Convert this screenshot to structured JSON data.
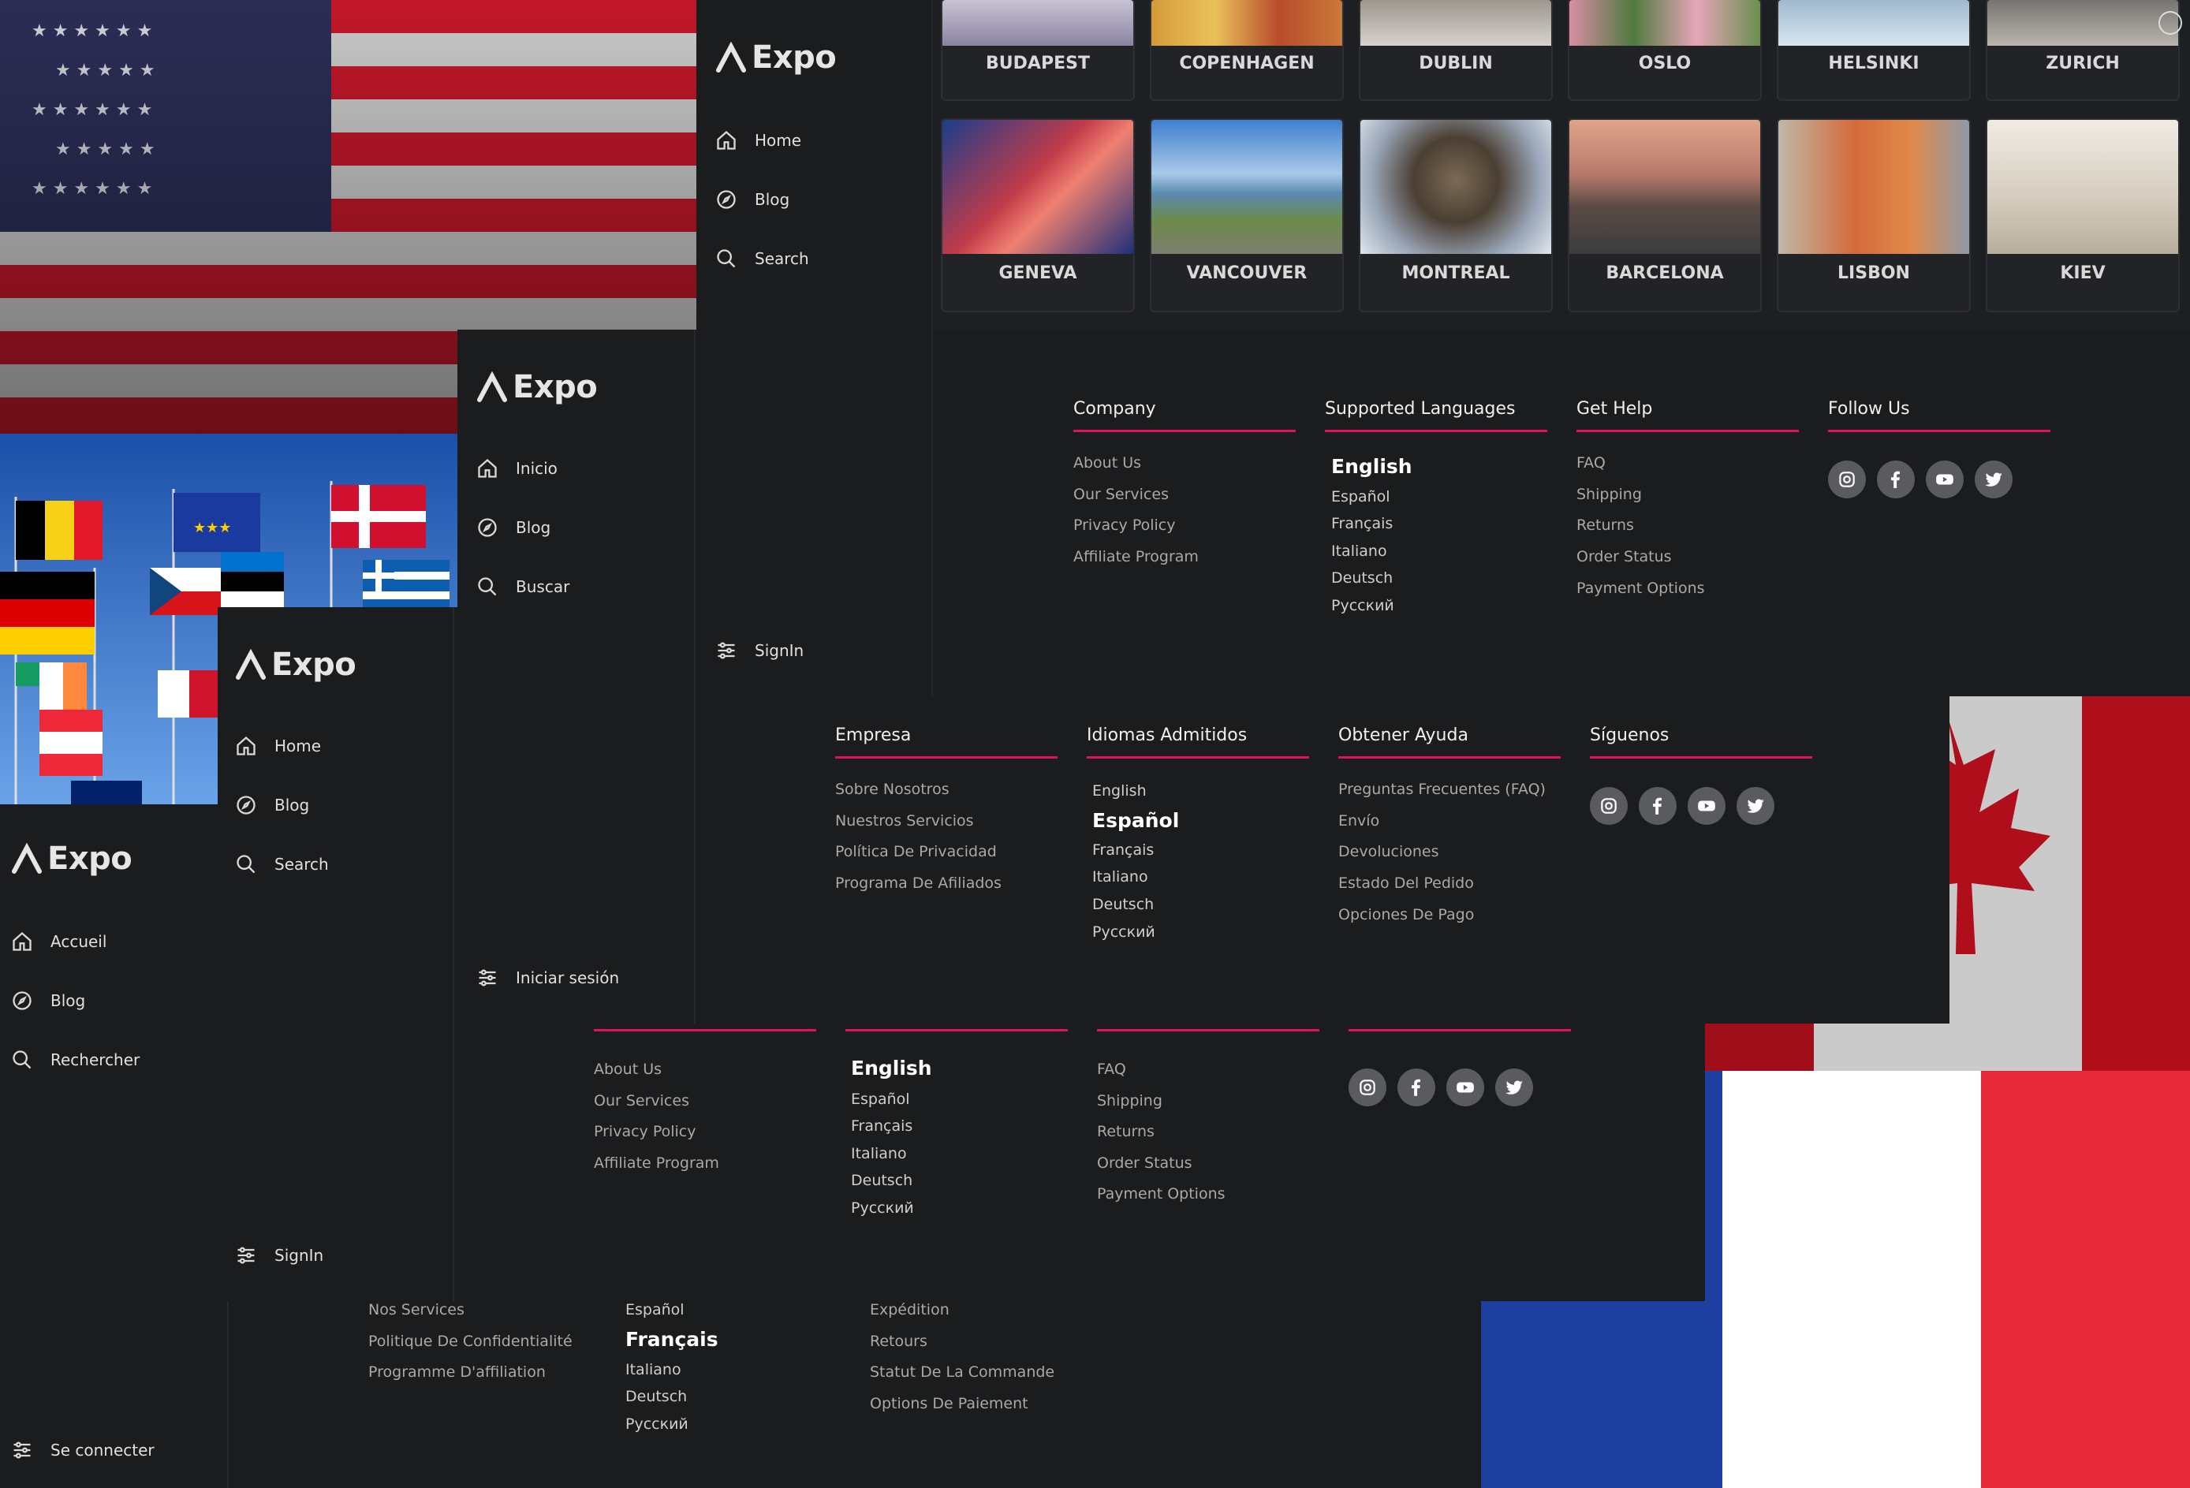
{
  "app": {
    "logo_text": "Expo"
  },
  "windows": {
    "en_top": {
      "nav": [
        "Home",
        "Blog",
        "Search"
      ],
      "signin": "SignIn",
      "cities_row1": [
        "BUDAPEST",
        "COPENHAGEN",
        "DUBLIN",
        "OSLO",
        "HELSINKI",
        "ZURICH"
      ],
      "cities_row2": [
        "GENEVA",
        "VANCOUVER",
        "MONTREAL",
        "BARCELONA",
        "LISBON",
        "KIEV"
      ],
      "footer": {
        "company": {
          "title": "Company",
          "links": [
            "About Us",
            "Our Services",
            "Privacy Policy",
            "Affiliate Program"
          ]
        },
        "languages": {
          "title": "Supported Languages",
          "items": [
            "English",
            "Español",
            "Français",
            "Italiano",
            "Deutsch",
            "Русский"
          ],
          "active": 0
        },
        "help": {
          "title": "Get Help",
          "links": [
            "FAQ",
            "Shipping",
            "Returns",
            "Order Status",
            "Payment Options"
          ]
        },
        "follow": {
          "title": "Follow Us",
          "icons": [
            "instagram-icon",
            "facebook-icon",
            "youtube-icon",
            "twitter-icon"
          ]
        }
      }
    },
    "es": {
      "nav": [
        "Inicio",
        "Blog",
        "Buscar"
      ],
      "signin": "Iniciar sesión",
      "footer": {
        "company": {
          "title": "Empresa",
          "links": [
            "Sobre Nosotros",
            "Nuestros Servicios",
            "Política De Privacidad",
            "Programa De Afiliados"
          ]
        },
        "languages": {
          "title": "Idiomas Admitidos",
          "items": [
            "English",
            "Español",
            "Français",
            "Italiano",
            "Deutsch",
            "Русский"
          ],
          "active": 1
        },
        "help": {
          "title": "Obtener Ayuda",
          "links": [
            "Preguntas Frecuentes (FAQ)",
            "Envío",
            "Devoluciones",
            "Estado Del Pedido",
            "Opciones De Pago"
          ]
        },
        "follow": {
          "title": "Síguenos"
        }
      }
    },
    "en_mid": {
      "nav": [
        "Home",
        "Blog",
        "Search"
      ],
      "signin": "SignIn",
      "footer": {
        "company": {
          "links": [
            "About Us",
            "Our Services",
            "Privacy Policy",
            "Affiliate Program"
          ]
        },
        "languages": {
          "items": [
            "English",
            "Español",
            "Français",
            "Italiano",
            "Deutsch",
            "Русский"
          ],
          "active": 0
        },
        "help": {
          "links": [
            "FAQ",
            "Shipping",
            "Returns",
            "Order Status",
            "Payment Options"
          ]
        }
      }
    },
    "fr": {
      "nav": [
        "Accueil",
        "Blog",
        "Rechercher"
      ],
      "signin": "Se connecter",
      "footer": {
        "company": {
          "links": [
            "Nos Services",
            "Politique De Confidentialité",
            "Programme D'affiliation"
          ]
        },
        "languages": {
          "items": [
            "Español",
            "Français",
            "Italiano",
            "Deutsch",
            "Русский"
          ],
          "active": 1
        },
        "help": {
          "links": [
            "Expédition",
            "Retours",
            "Statut De La Commande",
            "Options De Paiement"
          ]
        }
      }
    }
  },
  "colors": {
    "accent": "#e0115f",
    "bg": "#1b1c1e",
    "text": "#d8d8d8"
  }
}
